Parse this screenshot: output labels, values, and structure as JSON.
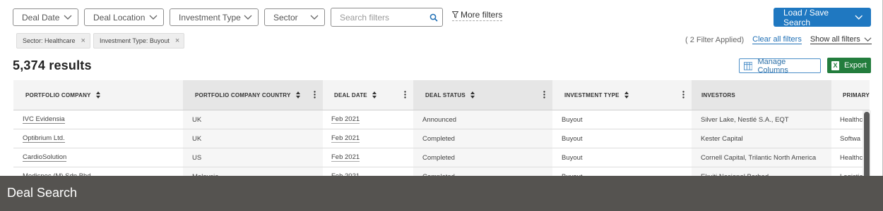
{
  "filters": {
    "dropdowns": [
      {
        "label": "Deal Date"
      },
      {
        "label": "Deal Location"
      },
      {
        "label": "Investment Type"
      },
      {
        "label": "Sector"
      }
    ],
    "search_placeholder": "Search filters",
    "more_label": "More filters"
  },
  "load_save_label": "Load / Save Search",
  "chips": [
    {
      "label": "Sector: Healthcare"
    },
    {
      "label": "Investment Type: Buyout"
    }
  ],
  "filter_status": {
    "applied": "( 2 Filter Applied)",
    "clear_all": "Clear all filters",
    "show_all": "Show all filters"
  },
  "results": "5,374 results",
  "manage_columns_label": "Manage Columns",
  "export_label": "Export",
  "table": {
    "columns": [
      {
        "label": "PORTFOLIO COMPANY"
      },
      {
        "label": "PORTFOLIO COMPANY COUNTRY"
      },
      {
        "label": "DEAL DATE"
      },
      {
        "label": "DEAL STATUS"
      },
      {
        "label": "INVESTMENT TYPE"
      },
      {
        "label": "INVESTORS"
      },
      {
        "label": "PRIMARY"
      }
    ],
    "rows": [
      [
        "IVC Evidensia",
        "UK",
        "Feb 2021",
        "Announced",
        "Buyout",
        "Silver Lake, Nestlé S.A., EQT",
        "Healthc"
      ],
      [
        "Optibrium Ltd.",
        "UK",
        "Feb 2021",
        "Completed",
        "Buyout",
        "Kester Capital",
        "Softwa"
      ],
      [
        "CardioSolution",
        "US",
        "Feb 2021",
        "Completed",
        "Buyout",
        "Cornell Capital, Trilantic North America",
        "Healthc"
      ],
      [
        "Medispec (M) Sdn Bhd",
        "Malaysia",
        "Feb 2021",
        "Completed",
        "Buyout",
        "Ekuiti Nasional Berhad",
        "Logistic"
      ]
    ]
  },
  "caption": "Deal Search",
  "colors": {
    "primary_blue": "#1f78c1",
    "export_green": "#237d3d",
    "caption_bg": "#555350"
  }
}
